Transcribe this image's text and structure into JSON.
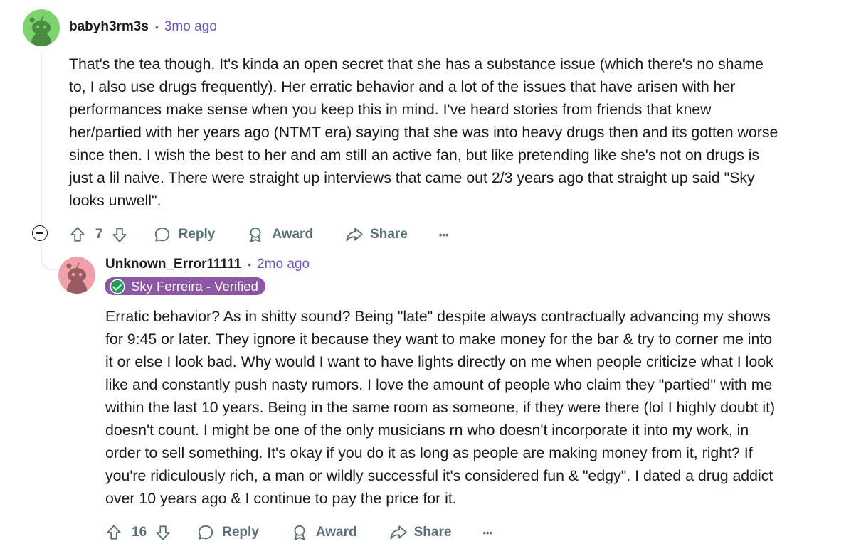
{
  "comment1": {
    "username": "babyh3rm3s",
    "separator": "•",
    "time": "3mo ago",
    "avatar_color": "#7ed46c",
    "lines": [
      "That's the tea though. It's kinda an open secret that she has a substance issue (which there's no shame",
      "to, I also use drugs frequently). Her erratic behavior and a lot of the issues that have arisen with her",
      "performances make sense when you keep this in mind. I've heard stories from friends that knew",
      "her/partied with her years ago (NTMT era) saying that she was into heavy drugs then and its gotten worse",
      "since then. I wish the best to her and am still an active fan, but like pretending like she's not on drugs is",
      "just a lil naive. There were straight up interviews that came out 2/3 years ago that straight up said \"Sky",
      "looks unwell\"."
    ],
    "votes": "7",
    "reply_label": "Reply",
    "award_label": "Award",
    "share_label": "Share",
    "more_label": "•••"
  },
  "comment2": {
    "username": "Unknown_Error11111",
    "separator": "•",
    "time": "2mo ago",
    "avatar_color": "#f0a0a8",
    "flair": "Sky Ferreira - Verified",
    "flair_color": "#8e56a6",
    "lines": [
      "Erratic behavior? As in shitty sound? Being \"late\" despite always contractually advancing my shows",
      "for 9:45 or later. They ignore it because they want to make money for the bar & try to corner me into",
      "it or else I look bad. Why would I want to have lights directly on me when people criticize what I look",
      "like and constantly push nasty rumors. I love the amount of people who claim they \"partied\" with me",
      "within the last 10 years. Being in the same room as someone, if they were there (lol I highly doubt it)",
      "doesn't count. I might be one of the only musicians rn who doesn't incorporate it into my work, in",
      "order to sell something. It's okay if you do it as long as people are making money from it, right? If",
      "you're ridiculously rich, a man or wildly successful it's considered fun & \"edgy\". I dated a drug addict",
      "over 10 years ago & I continue to pay the price for it."
    ],
    "votes": "16",
    "reply_label": "Reply",
    "award_label": "Award",
    "share_label": "Share",
    "more_label": "•••"
  }
}
